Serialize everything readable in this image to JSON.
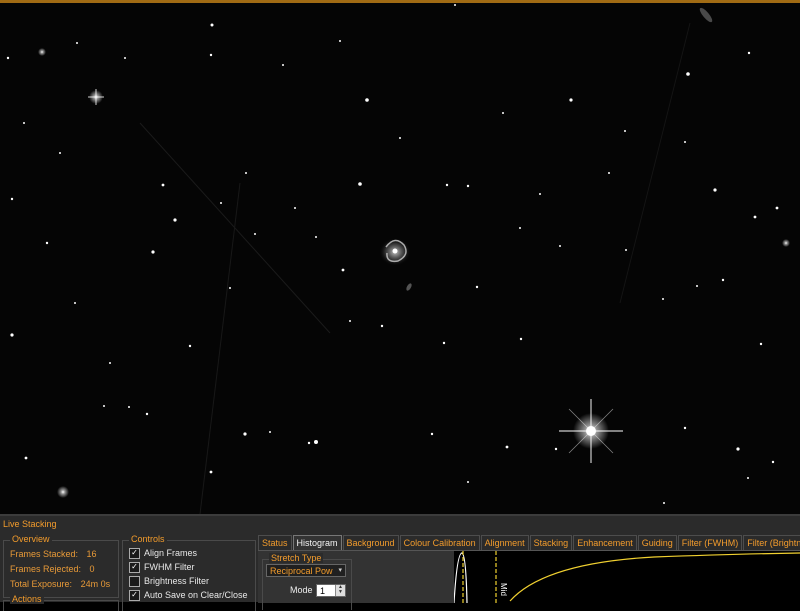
{
  "image": {
    "description": "stacked star field with spiral galaxy"
  },
  "panel": {
    "title": "Live Stacking",
    "overview": {
      "label": "Overview",
      "frames_stacked_label": "Frames Stacked:",
      "frames_stacked_value": "16",
      "frames_rejected_label": "Frames Rejected:",
      "frames_rejected_value": "0",
      "total_exposure_label": "Total Exposure:",
      "total_exposure_value": "24m 0s"
    },
    "actions": {
      "label": "Actions"
    },
    "controls": {
      "label": "Controls",
      "items": [
        {
          "label": "Align Frames",
          "checked": true
        },
        {
          "label": "FWHM Filter",
          "checked": true
        },
        {
          "label": "Brightness Filter",
          "checked": false
        },
        {
          "label": "Auto Save on Clear/Close",
          "checked": true
        }
      ]
    },
    "tabs": [
      "Status",
      "Histogram",
      "Background",
      "Colour Calibration",
      "Alignment",
      "Stacking",
      "Enhancement",
      "Guiding",
      "Filter (FWHM)",
      "Filter (Brightness)"
    ],
    "active_tab": "Histogram",
    "histogram": {
      "stretch_type_label": "Stretch Type",
      "stretch_type_value": "Reciprocal Pow",
      "mode_label": "Mode",
      "mode_value": "1",
      "marker_label": "Mid",
      "accent_color": "#f0d030"
    }
  },
  "colors": {
    "accent": "#f39c2c",
    "top_rule": "#a06b14"
  }
}
